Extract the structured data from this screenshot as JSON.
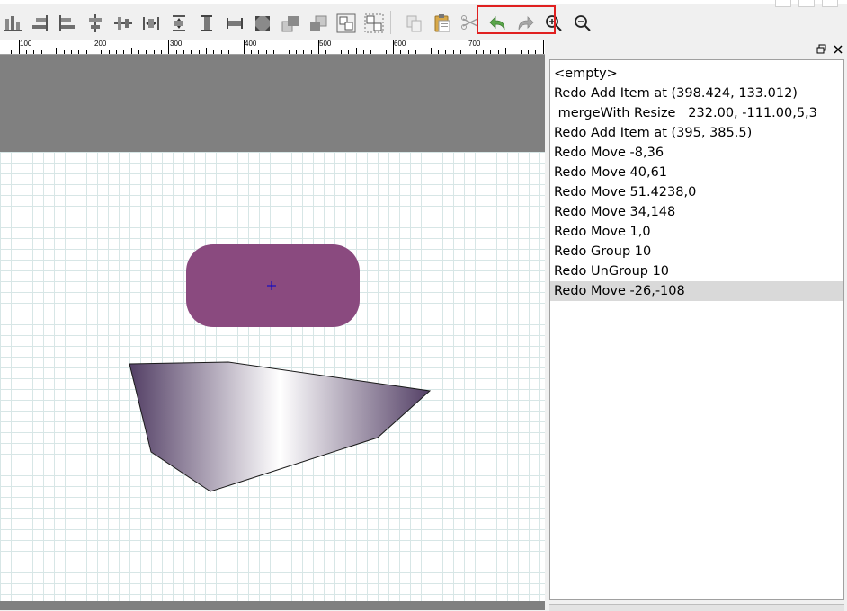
{
  "toolbar": {
    "buttons": [
      {
        "name": "align-bottom-icon"
      },
      {
        "name": "align-right-icon"
      },
      {
        "name": "align-left-icon"
      },
      {
        "name": "align-horizontal-center-icon"
      },
      {
        "name": "align-vertical-center-icon"
      },
      {
        "name": "distribute-horizontal-icon"
      },
      {
        "name": "distribute-vertical-icon"
      },
      {
        "name": "same-height-icon"
      },
      {
        "name": "same-width-icon"
      },
      {
        "name": "same-size-icon"
      },
      {
        "name": "bring-to-front-icon"
      },
      {
        "name": "send-to-back-icon"
      },
      {
        "name": "group-icon"
      },
      {
        "name": "ungroup-icon"
      },
      {
        "name": "copy-icon"
      },
      {
        "name": "paste-icon"
      },
      {
        "name": "cut-icon"
      },
      {
        "name": "undo-icon"
      },
      {
        "name": "redo-icon"
      },
      {
        "name": "zoom-in-icon"
      },
      {
        "name": "zoom-out-icon"
      }
    ],
    "undo_color": "#5aa64a",
    "redo_color": "#9a9a9a",
    "highlight_color": "#e02020"
  },
  "ruler": {
    "labels": [
      "100",
      "200",
      "300",
      "400",
      "500",
      "600",
      "700"
    ]
  },
  "canvas": {
    "rounded_rect_color": "#8a4a7f",
    "center_marker_color": "#0000cc",
    "polygon_gradient": [
      "#544066",
      "#ffffff",
      "#544066"
    ]
  },
  "undo_stack": {
    "items": [
      "<empty>",
      "Redo Add Item at (398.424, 133.012)",
      " mergeWith Resize   232.00, -111.00,5,3",
      "Redo Add Item at (395, 385.5)",
      "Redo Move -8,36",
      "Redo Move 40,61",
      "Redo Move 51.4238,0",
      "Redo Move 34,148",
      "Redo Move 1,0",
      "Redo Group 10",
      "Redo UnGroup 10",
      "Redo Move -26,-108"
    ],
    "selected_index": 11
  }
}
